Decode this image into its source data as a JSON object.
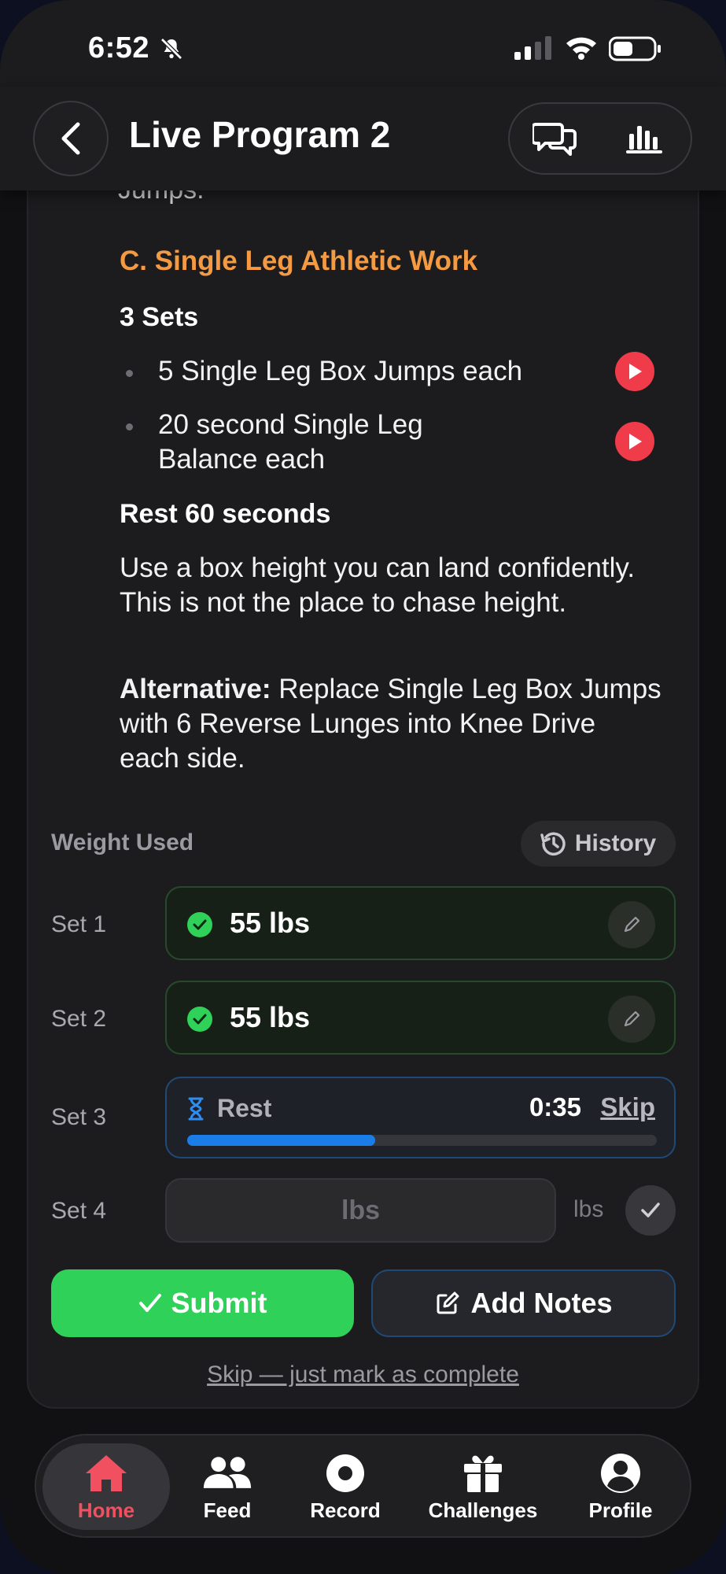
{
  "status_bar": {
    "time": "6:52"
  },
  "header": {
    "title": "Live Program 2"
  },
  "content": {
    "cut_text": "Jumps.",
    "section_heading": "C. Single Leg Athletic Work",
    "sets_label": "3 Sets",
    "exercises": [
      {
        "label": "5 Single Leg Box Jumps each"
      },
      {
        "label": "20 second Single Leg Balance each"
      }
    ],
    "rest_label": "Rest 60 seconds",
    "note": "Use a box height you can land confidently. This is not the place to chase height.",
    "alternative_label": "Alternative:",
    "alternative_text": " Replace Single Leg Box Jumps with 6 Reverse Lunges into Knee Drive each side."
  },
  "tracker": {
    "weight_used_label": "Weight Used",
    "history_label": "History",
    "sets": [
      {
        "label": "Set 1",
        "value": "55 lbs",
        "state": "done"
      },
      {
        "label": "Set 2",
        "value": "55 lbs",
        "state": "done"
      },
      {
        "label": "Set 3",
        "state": "rest",
        "rest_label": "Rest",
        "timer": "0:35",
        "skip_label": "Skip",
        "progress": 0.4
      },
      {
        "label": "Set 4",
        "state": "input",
        "placeholder": "lbs",
        "unit": "lbs"
      }
    ],
    "submit_label": "Submit",
    "add_notes_label": "Add Notes",
    "skip_complete_label": "Skip — just mark as complete"
  },
  "colors": {
    "accent_orange": "#f49a42",
    "success_green": "#2fd158",
    "play_red": "#f03c4a",
    "progress_blue": "#1b7ee8",
    "active_tab_red": "#f05060"
  },
  "tab_bar": {
    "items": [
      {
        "label": "Home",
        "icon": "home-icon",
        "active": true
      },
      {
        "label": "Feed",
        "icon": "people-icon",
        "active": false
      },
      {
        "label": "Record",
        "icon": "record-icon",
        "active": false
      },
      {
        "label": "Challenges",
        "icon": "gift-icon",
        "active": false
      },
      {
        "label": "Profile",
        "icon": "profile-icon",
        "active": false
      }
    ]
  }
}
